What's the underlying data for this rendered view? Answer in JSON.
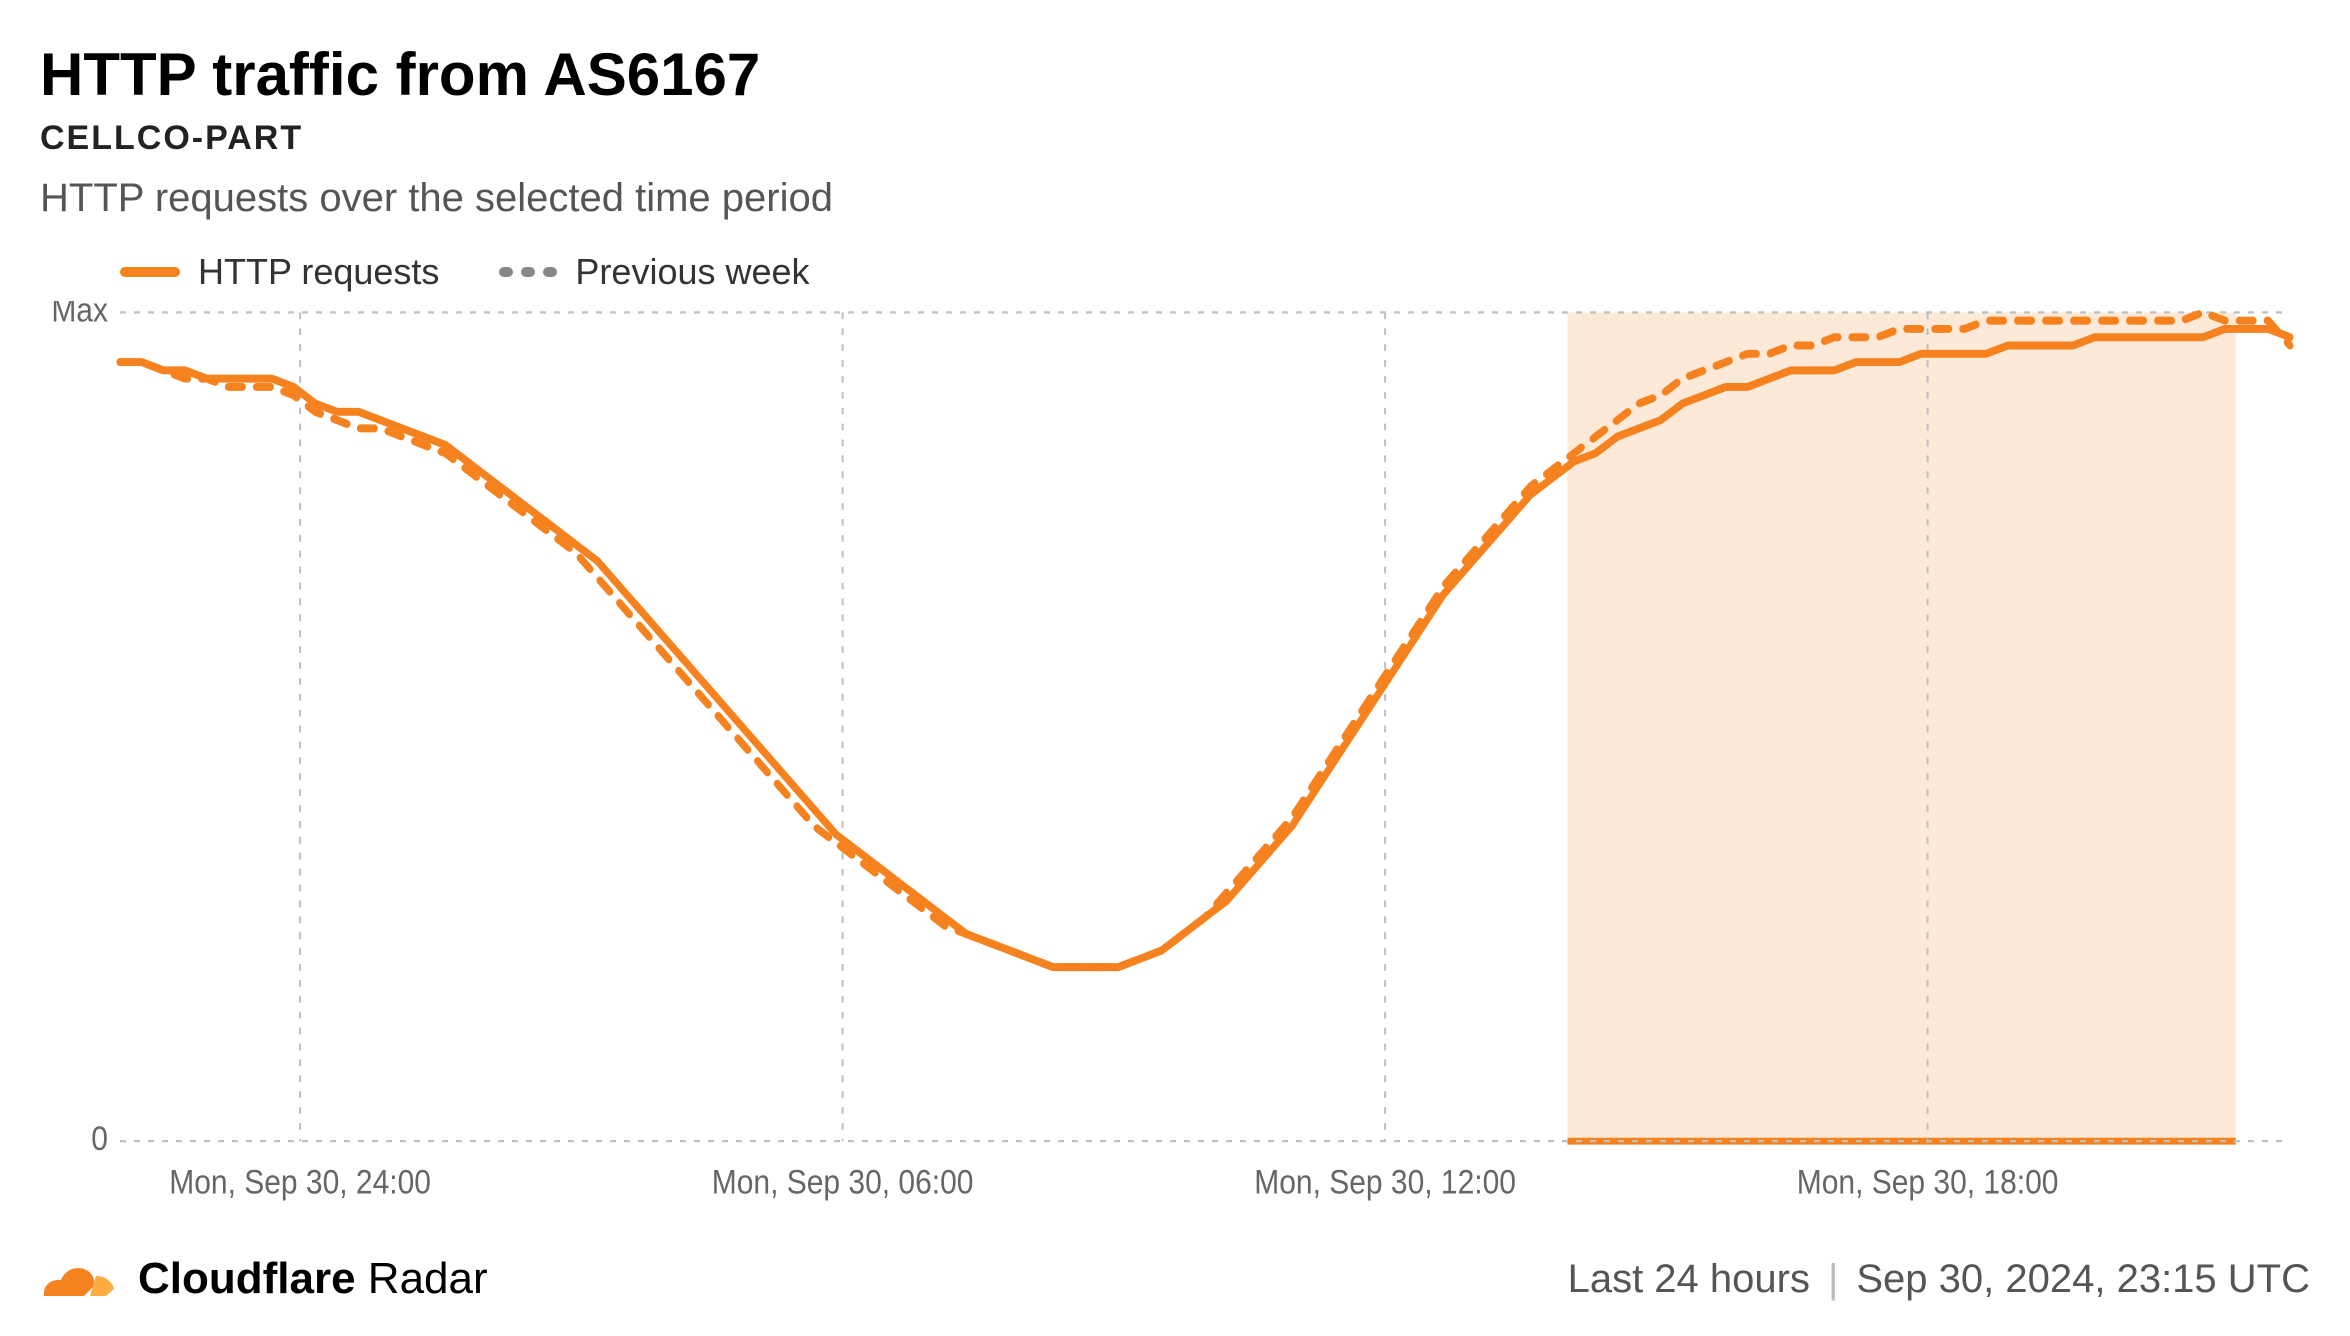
{
  "title": "HTTP traffic from AS6167",
  "subtitle": "CELLCO-PART",
  "description": "HTTP requests over the selected time period",
  "legend": {
    "series1": "HTTP requests",
    "series2": "Previous week"
  },
  "footer": {
    "brand_bold": "Cloudflare",
    "brand_light": " Radar",
    "range": "Last 24 hours",
    "timestamp": "Sep 30, 2024, 23:15 UTC"
  },
  "colors": {
    "accent": "#f6821f",
    "grid": "#bfbfbf",
    "shade": "#fbe0c6",
    "text_muted": "#666"
  },
  "chart_data": {
    "type": "line",
    "ylabel": "",
    "xlabel": "",
    "ylim": [
      0,
      100
    ],
    "y_ticks": [
      "0",
      "Max"
    ],
    "x_ticks": [
      "Mon, Sep 30, 24:00",
      "Mon, Sep 30, 06:00",
      "Mon, Sep 30, 12:00",
      "Mon, Sep 30, 18:00"
    ],
    "x_tick_positions": [
      0.083,
      0.333,
      0.583,
      0.833
    ],
    "x": [
      0.0,
      0.01,
      0.02,
      0.03,
      0.04,
      0.05,
      0.06,
      0.07,
      0.08,
      0.09,
      0.1,
      0.11,
      0.12,
      0.13,
      0.14,
      0.15,
      0.16,
      0.17,
      0.18,
      0.19,
      0.2,
      0.21,
      0.22,
      0.23,
      0.24,
      0.25,
      0.26,
      0.27,
      0.28,
      0.29,
      0.3,
      0.31,
      0.32,
      0.33,
      0.34,
      0.35,
      0.36,
      0.37,
      0.38,
      0.39,
      0.4,
      0.41,
      0.42,
      0.43,
      0.44,
      0.45,
      0.46,
      0.47,
      0.48,
      0.49,
      0.5,
      0.51,
      0.52,
      0.53,
      0.54,
      0.55,
      0.56,
      0.57,
      0.58,
      0.59,
      0.6,
      0.61,
      0.62,
      0.63,
      0.64,
      0.65,
      0.66,
      0.67,
      0.68,
      0.69,
      0.7,
      0.71,
      0.72,
      0.73,
      0.74,
      0.75,
      0.76,
      0.77,
      0.78,
      0.79,
      0.8,
      0.81,
      0.82,
      0.83,
      0.84,
      0.85,
      0.86,
      0.87,
      0.88,
      0.89,
      0.9,
      0.91,
      0.92,
      0.93,
      0.94,
      0.95,
      0.96,
      0.97,
      0.98,
      0.99,
      1.0
    ],
    "shaded_region": [
      0.667,
      0.975
    ],
    "series": [
      {
        "name": "HTTP requests",
        "style": "solid",
        "color": "#f6821f",
        "values": [
          94,
          94,
          93,
          93,
          92,
          92,
          92,
          92,
          91,
          89,
          88,
          88,
          87,
          86,
          85,
          84,
          82,
          80,
          78,
          76,
          74,
          72,
          70,
          67,
          64,
          61,
          58,
          55,
          52,
          49,
          46,
          43,
          40,
          37,
          35,
          33,
          31,
          29,
          27,
          25,
          24,
          23,
          22,
          21,
          21,
          21,
          21,
          22,
          23,
          25,
          27,
          29,
          32,
          35,
          38,
          42,
          46,
          50,
          54,
          58,
          62,
          66,
          69,
          72,
          75,
          78,
          80,
          82,
          83,
          85,
          86,
          87,
          89,
          90,
          91,
          91,
          92,
          93,
          93,
          93,
          94,
          94,
          94,
          95,
          95,
          95,
          95,
          96,
          96,
          96,
          96,
          97,
          97,
          97,
          97,
          97,
          97,
          98,
          98,
          98,
          97
        ]
      },
      {
        "name": "Previous week",
        "style": "dashed",
        "color": "#f6821f",
        "values": [
          94,
          94,
          93,
          92,
          92,
          91,
          91,
          91,
          90,
          88,
          87,
          86,
          86,
          85,
          84,
          83,
          81,
          79,
          77,
          75,
          73,
          71,
          68,
          65,
          62,
          59,
          56,
          53,
          50,
          47,
          44,
          41,
          38,
          36,
          34,
          32,
          30,
          28,
          26,
          25,
          24,
          23,
          22,
          21,
          21,
          21,
          21,
          22,
          23,
          25,
          27,
          30,
          33,
          36,
          39,
          43,
          47,
          51,
          55,
          59,
          63,
          67,
          70,
          73,
          76,
          79,
          81,
          83,
          85,
          87,
          89,
          90,
          92,
          93,
          94,
          95,
          95,
          96,
          96,
          97,
          97,
          97,
          98,
          98,
          98,
          98,
          99,
          99,
          99,
          99,
          99,
          99,
          99,
          99,
          99,
          99,
          100,
          99,
          99,
          99,
          96
        ]
      }
    ]
  }
}
